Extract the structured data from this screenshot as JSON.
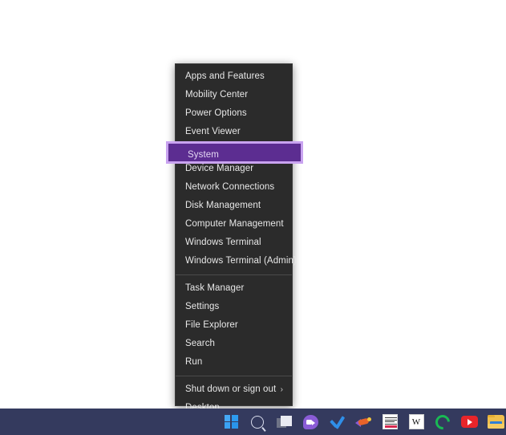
{
  "desktop": {
    "background_color": "#ffffff"
  },
  "context_menu": {
    "name": "Windows quick-link (Win+X) menu",
    "background_color": "#2b2b2b",
    "highlight_color": "#5c2d91",
    "highlight_border_color": "#c9a3f0",
    "items": [
      {
        "label": "Apps and Features",
        "selected": false,
        "submenu": false
      },
      {
        "label": "Mobility Center",
        "selected": false,
        "submenu": false
      },
      {
        "label": "Power Options",
        "selected": false,
        "submenu": false
      },
      {
        "label": "Event Viewer",
        "selected": false,
        "submenu": false
      },
      {
        "label": "System",
        "selected": true,
        "submenu": false
      },
      {
        "label": "Device Manager",
        "selected": false,
        "submenu": false
      },
      {
        "label": "Network Connections",
        "selected": false,
        "submenu": false
      },
      {
        "label": "Disk Management",
        "selected": false,
        "submenu": false
      },
      {
        "label": "Computer Management",
        "selected": false,
        "submenu": false
      },
      {
        "label": "Windows Terminal",
        "selected": false,
        "submenu": false
      },
      {
        "label": "Windows Terminal (Admin)",
        "selected": false,
        "submenu": false
      },
      {
        "label": "Task Manager",
        "selected": false,
        "submenu": false
      },
      {
        "label": "Settings",
        "selected": false,
        "submenu": false
      },
      {
        "label": "File Explorer",
        "selected": false,
        "submenu": false
      },
      {
        "label": "Search",
        "selected": false,
        "submenu": false
      },
      {
        "label": "Run",
        "selected": false,
        "submenu": false
      },
      {
        "label": "Shut down or sign out",
        "selected": false,
        "submenu": true,
        "chevron": "›"
      },
      {
        "label": "Desktop",
        "selected": false,
        "submenu": false
      }
    ]
  },
  "taskbar": {
    "background_color": "#343a5e",
    "icons": [
      {
        "name": "start-button-icon",
        "label": "Start"
      },
      {
        "name": "search-icon",
        "label": "Search"
      },
      {
        "name": "task-view-icon",
        "label": "Task View"
      },
      {
        "name": "chat-icon",
        "label": "Chat"
      },
      {
        "name": "checkmark-icon",
        "label": "Checkmark"
      },
      {
        "name": "rocket-icon",
        "label": "Rocket"
      },
      {
        "name": "news-tile-icon",
        "label": "News"
      },
      {
        "name": "wikipedia-icon",
        "label": "W"
      },
      {
        "name": "green-ring-icon",
        "label": "Spotify"
      },
      {
        "name": "youtube-icon",
        "label": "YouTube"
      },
      {
        "name": "file-explorer-icon",
        "label": "File Explorer"
      }
    ]
  }
}
